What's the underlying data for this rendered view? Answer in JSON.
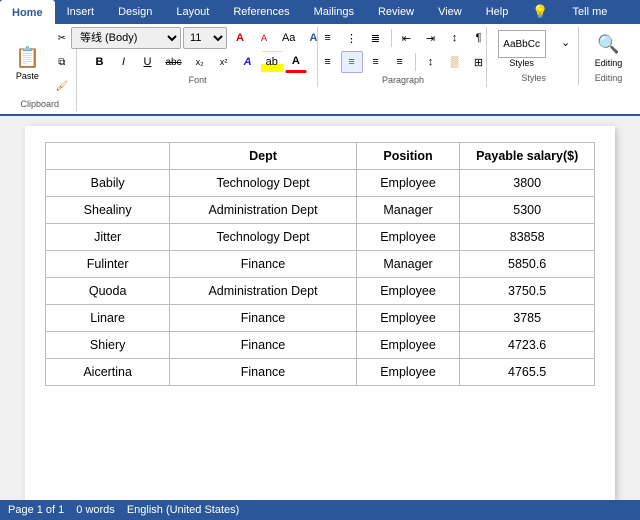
{
  "ribbon": {
    "tabs": [
      "Home",
      "Insert",
      "Design",
      "Layout",
      "References",
      "Mailings",
      "Review",
      "View",
      "Help",
      "💡",
      "Tell me"
    ],
    "active_tab": "Home",
    "groups": {
      "font": {
        "label": "Font",
        "font_name": "等线 (Body)",
        "font_size": "11"
      },
      "paragraph": {
        "label": "Paragraph"
      },
      "styles": {
        "label": "Styles",
        "button": "Styles"
      },
      "editing": {
        "label": "Editing",
        "button": "Editing"
      }
    }
  },
  "table": {
    "headers": [
      "",
      "Dept",
      "Position",
      "Payable salary($)"
    ],
    "rows": [
      {
        "name": "Babily",
        "dept": "Technology Dept",
        "position": "Employee",
        "salary": "3800"
      },
      {
        "name": "Shealiny",
        "dept": "Administration Dept",
        "position": "Manager",
        "salary": "5300"
      },
      {
        "name": "Jitter",
        "dept": "Technology Dept",
        "position": "Employee",
        "salary": "83858"
      },
      {
        "name": "Fulinter",
        "dept": "Finance",
        "position": "Manager",
        "salary": "5850.6"
      },
      {
        "name": "Quoda",
        "dept": "Administration Dept",
        "position": "Employee",
        "salary": "3750.5"
      },
      {
        "name": "Linare",
        "dept": "Finance",
        "position": "Employee",
        "salary": "3785"
      },
      {
        "name": "Shiery",
        "dept": "Finance",
        "position": "Employee",
        "salary": "4723.6"
      },
      {
        "name": "Aicertina",
        "dept": "Finance",
        "position": "Employee",
        "salary": "4765.5"
      }
    ]
  },
  "status": {
    "page": "Page 1 of 1",
    "words": "0 words",
    "lang": "English (United States)"
  }
}
